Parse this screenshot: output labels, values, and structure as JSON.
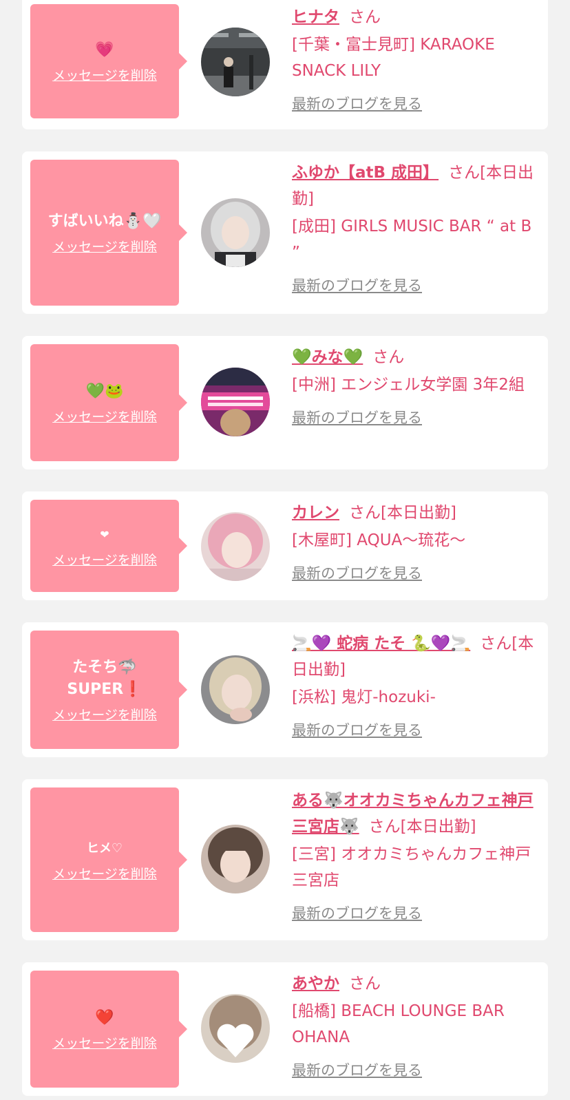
{
  "delete_label": "メッセージを削除",
  "blog_label": "最新のブログを見る",
  "san_label": "さん",
  "colors": {
    "accent": "#e0486e",
    "bubble": "#ff95a3",
    "card": "#ffffff",
    "background": "#f2f2f2",
    "link_gray": "#8a8a8a"
  },
  "entries": [
    {
      "message": "💗",
      "name": "ヒナタ",
      "suffix": "",
      "shop": "[千葉・富士見町] KARAOKE SNACK LILY",
      "avatar_icon": "woman-in-parking-lot-photo"
    },
    {
      "message": "すばいいね⛄🤍",
      "name": "ふゆか【atB 成田】",
      "suffix": "[本日出勤]",
      "shop": "[成田] GIRLS MUSIC BAR “ at B ”",
      "avatar_icon": "silver-hair-girl-photo"
    },
    {
      "message": "💚🐸",
      "name": "💚みな💚",
      "suffix": "",
      "shop": "[中洲] エンジェル女学園 3年2組",
      "avatar_icon": "school-girl-poster-photo"
    },
    {
      "message": "❤",
      "name": "カレン",
      "suffix": "[本日出勤]",
      "shop": "[木屋町] AQUA〜琉花〜",
      "avatar_icon": "pink-hair-girl-photo"
    },
    {
      "message": "たそち🦈 SUPER❗",
      "name": "🚬💜 蛇病 たそ 🐍💜🚬",
      "suffix": "[本日出勤]",
      "shop": "[浜松] 鬼灯-hozuki-",
      "avatar_icon": "blonde-girl-selfie-photo"
    },
    {
      "message": "ヒメ♡",
      "name": "ある🐺オオカミちゃんカフェ神戸三宮店🐺",
      "suffix": "[本日出勤]",
      "shop": "[三宮] オオカミちゃんカフェ神戸三宮店",
      "avatar_icon": "brown-hair-girl-photo"
    },
    {
      "message": "❤️",
      "name": "あやか",
      "suffix": "",
      "shop": "[船橋] BEACH LOUNGE BAR OHANA",
      "avatar_icon": "heart-covered-face-photo"
    }
  ]
}
